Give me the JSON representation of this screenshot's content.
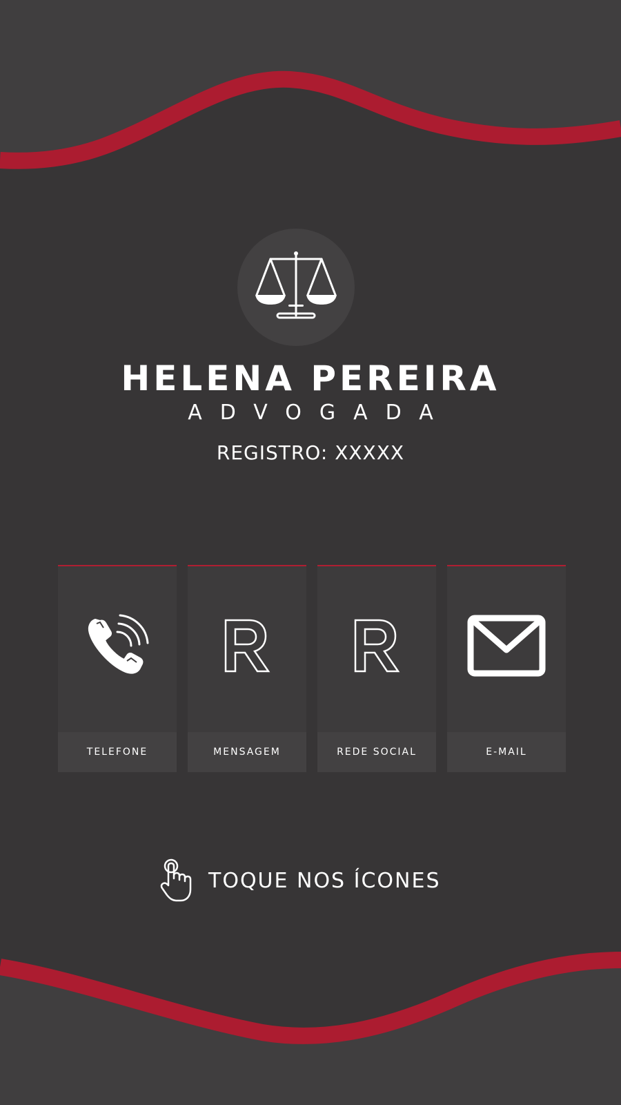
{
  "profile": {
    "name": "HELENA PEREIRA",
    "role": "ADVOGADA",
    "registration": "REGISTRO: XXXXX"
  },
  "contacts": [
    {
      "label": "TELEFONE",
      "icon": "phone-icon"
    },
    {
      "label": "MENSAGEM",
      "icon": "letter-r-icon"
    },
    {
      "label": "REDE SOCIAL",
      "icon": "letter-r-icon"
    },
    {
      "label": "E-MAIL",
      "icon": "envelope-icon"
    }
  ],
  "cta": {
    "text": "TOQUE NOS ÍCONES",
    "icon": "hand-tap-icon"
  },
  "logo": {
    "icon": "scales-of-justice-icon"
  },
  "colors": {
    "background": "#373536",
    "accent": "#b01e31",
    "tile": "#3d3b3c",
    "tile_label_bar": "#434142",
    "text": "#ffffff"
  }
}
